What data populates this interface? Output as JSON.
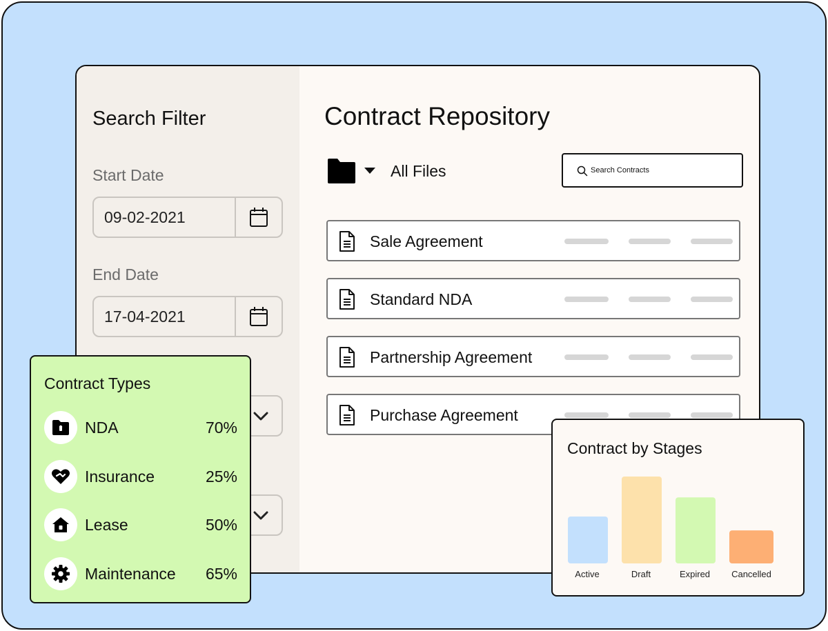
{
  "sidebar": {
    "title": "Search Filter",
    "start_date": {
      "label": "Start Date",
      "value": "09-02-2021"
    },
    "end_date": {
      "label": "End Date",
      "value": "17-04-2021"
    }
  },
  "main": {
    "title": "Contract Repository",
    "folder_label": "All Files",
    "search_placeholder": "Search Contracts",
    "files": [
      {
        "name": "Sale Agreement"
      },
      {
        "name": "Standard NDA"
      },
      {
        "name": "Partnership Agreement"
      },
      {
        "name": "Purchase Agreement"
      }
    ]
  },
  "contract_types": {
    "title": "Contract Types",
    "items": [
      {
        "label": "NDA",
        "percent": "70%",
        "icon": "locked-folder-icon"
      },
      {
        "label": "Insurance",
        "percent": "25%",
        "icon": "handshake-heart-icon"
      },
      {
        "label": "Lease",
        "percent": "50%",
        "icon": "house-icon"
      },
      {
        "label": "Maintenance",
        "percent": "65%",
        "icon": "gear-icon"
      }
    ]
  },
  "stages": {
    "title": "Contract by Stages"
  },
  "chart_data": {
    "type": "bar",
    "title": "Contract by Stages",
    "categories": [
      "Active",
      "Draft",
      "Expired",
      "Cancelled"
    ],
    "values": [
      54,
      100,
      76,
      38
    ],
    "ylim": [
      0,
      100
    ],
    "colors": [
      "#c3e0fd",
      "#fde1ab",
      "#d3f9b2",
      "#fdaf74"
    ],
    "grid": false
  },
  "colors": {
    "background": "#c3e0fd",
    "window": "#fdf9f5",
    "sidebar": "#f3efea",
    "types_card": "#d3f9b2"
  }
}
